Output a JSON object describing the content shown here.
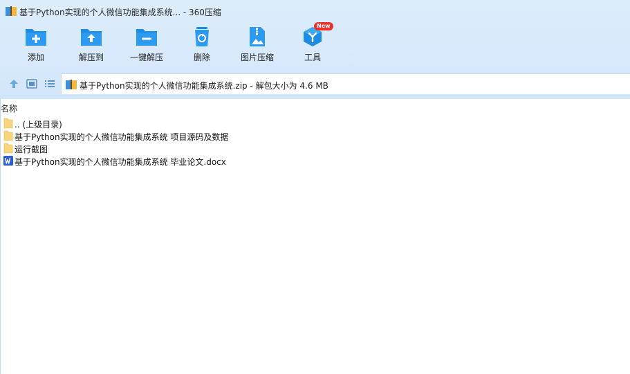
{
  "window": {
    "title": "基于Python实现的个人微信功能集成系统... - 360压缩"
  },
  "toolbar": {
    "items": [
      {
        "label": "添加",
        "icon": "add-folder-icon"
      },
      {
        "label": "解压到",
        "icon": "extract-to-icon"
      },
      {
        "label": "一键解压",
        "icon": "one-click-extract-icon"
      },
      {
        "label": "删除",
        "icon": "recycle-bin-icon"
      },
      {
        "label": "图片压缩",
        "icon": "image-compress-icon"
      },
      {
        "label": "工具",
        "icon": "tools-cube-icon",
        "badge": "New"
      }
    ]
  },
  "address": {
    "text": "基于Python实现的个人微信功能集成系统.zip - 解包大小为 4.6 MB"
  },
  "list": {
    "header": "名称",
    "rows": [
      {
        "name": ".. (上级目录)",
        "type": "folder"
      },
      {
        "name": "基于Python实现的个人微信功能集成系统 项目源码及数据",
        "type": "folder"
      },
      {
        "name": "运行截图",
        "type": "folder"
      },
      {
        "name": "基于Python实现的个人微信功能集成系统 毕业论文.docx",
        "type": "word"
      }
    ]
  },
  "colors": {
    "accent": "#1b8ce3",
    "toolbar_bg": "#d7e9fb",
    "folder": "#f7d57a",
    "word": "#2b5fd9",
    "badge": "#e8322c"
  }
}
